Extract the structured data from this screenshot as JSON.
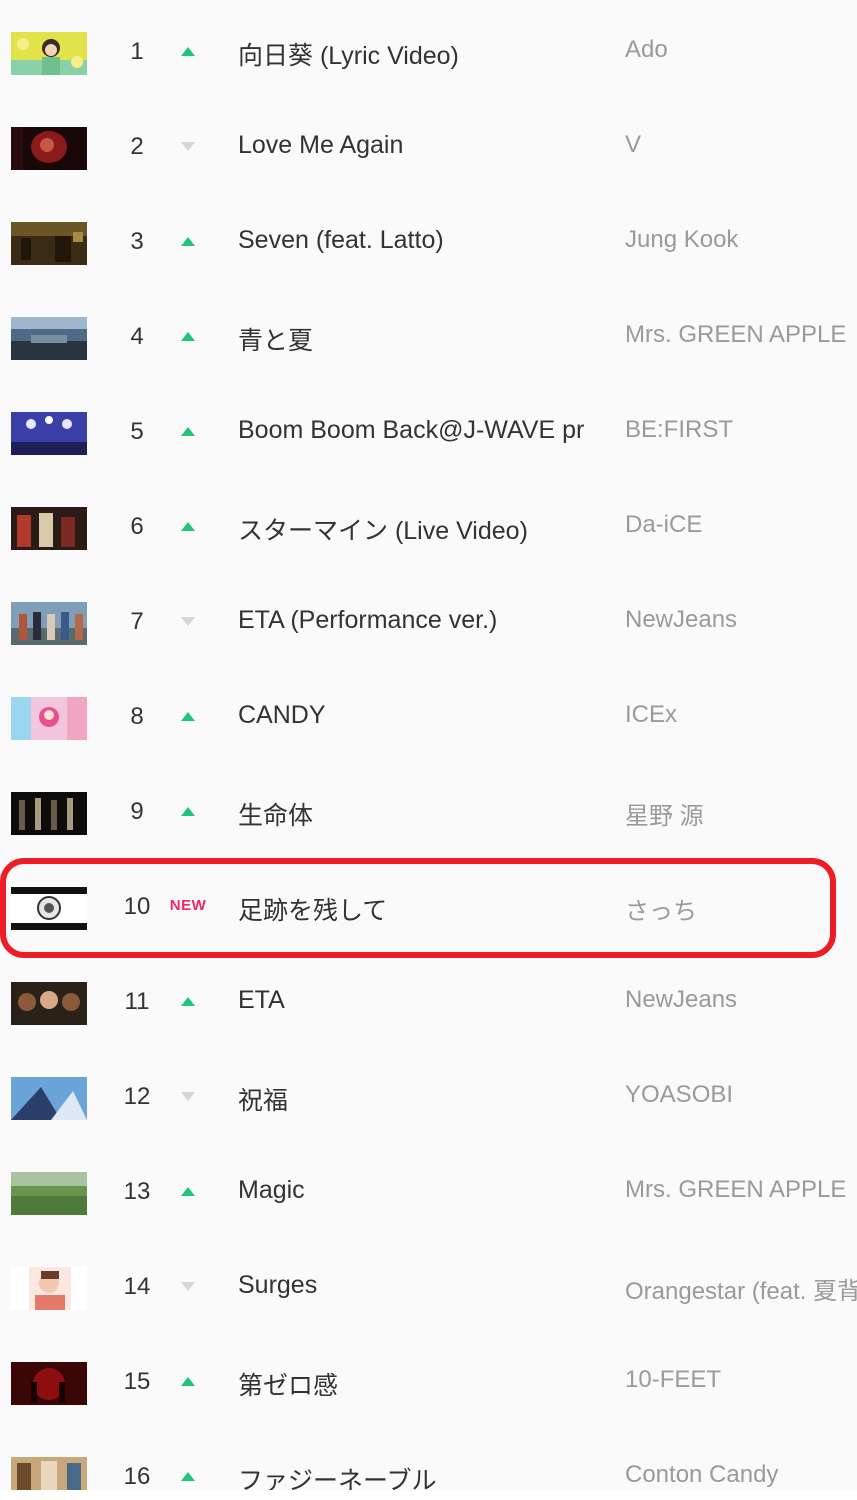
{
  "chart": {
    "rows": [
      {
        "rank": "1",
        "trend": "up",
        "title": "向日葵 (Lyric Video)",
        "artist": "Ado"
      },
      {
        "rank": "2",
        "trend": "down",
        "title": "Love Me Again",
        "artist": "V"
      },
      {
        "rank": "3",
        "trend": "up",
        "title": "Seven (feat. Latto)",
        "artist": "Jung Kook"
      },
      {
        "rank": "4",
        "trend": "up",
        "title": "青と夏",
        "artist": "Mrs. GREEN APPLE"
      },
      {
        "rank": "5",
        "trend": "up",
        "title": "Boom Boom Back@J-WAVE pr",
        "artist": "BE:FIRST"
      },
      {
        "rank": "6",
        "trend": "up",
        "title": "スターマイン (Live Video)",
        "artist": "Da-iCE"
      },
      {
        "rank": "7",
        "trend": "down",
        "title": "ETA (Performance ver.)",
        "artist": "NewJeans"
      },
      {
        "rank": "8",
        "trend": "up",
        "title": "CANDY",
        "artist": "ICEx"
      },
      {
        "rank": "9",
        "trend": "up",
        "title": "生命体",
        "artist": "星野 源"
      },
      {
        "rank": "10",
        "trend": "new",
        "title": "足跡を残して",
        "artist": "さっち",
        "badge": "NEW"
      },
      {
        "rank": "11",
        "trend": "up",
        "title": "ETA",
        "artist": "NewJeans"
      },
      {
        "rank": "12",
        "trend": "down",
        "title": "祝福",
        "artist": "YOASOBI"
      },
      {
        "rank": "13",
        "trend": "up",
        "title": "Magic",
        "artist": "Mrs. GREEN APPLE"
      },
      {
        "rank": "14",
        "trend": "down",
        "title": "Surges",
        "artist": "Orangestar (feat. 夏背"
      },
      {
        "rank": "15",
        "trend": "up",
        "title": "第ゼロ感",
        "artist": "10-FEET"
      },
      {
        "rank": "16",
        "trend": "up",
        "title": "ファジーネーブル",
        "artist": "Conton Candy"
      }
    ]
  },
  "colors": {
    "trend_up": "#21c47b",
    "trend_down": "#d6d6d6",
    "new_badge": "#f0266e",
    "highlight": "#ee1c24"
  }
}
